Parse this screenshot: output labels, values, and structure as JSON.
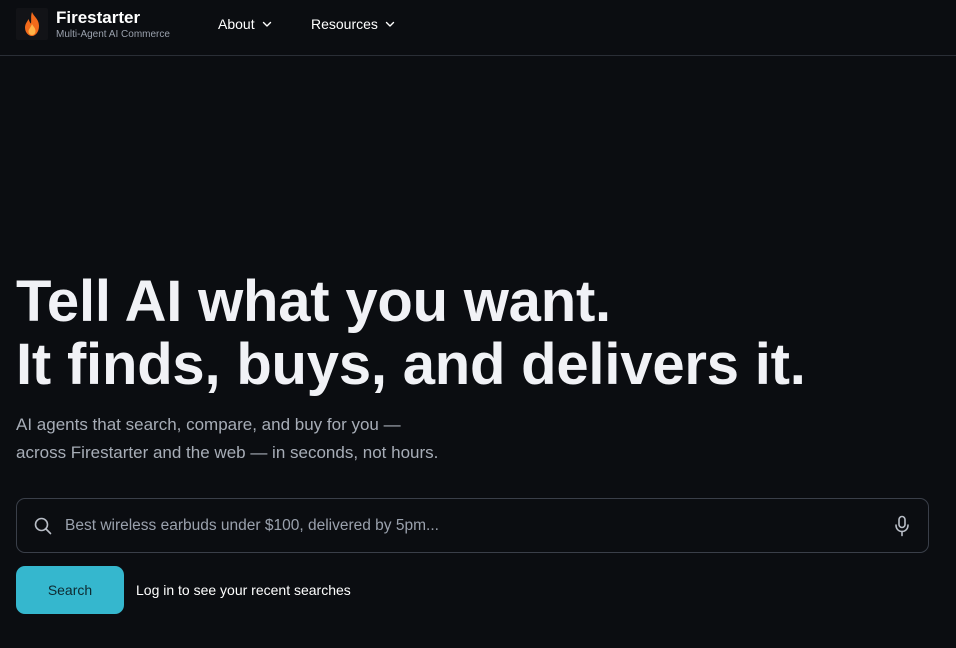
{
  "brand": {
    "name": "Firestarter",
    "tagline": "Multi-Agent AI Commerce",
    "logo_icon": "flame-icon",
    "accent_color": "#f26a1b"
  },
  "nav": {
    "items": [
      {
        "label": "About",
        "icon": "chevron-down-icon"
      },
      {
        "label": "Resources",
        "icon": "chevron-down-icon"
      }
    ]
  },
  "hero": {
    "title_lines": [
      "Tell AI what you want.",
      "It finds, buys, and delivers it."
    ],
    "subtitle_lines": [
      "AI agents that search, compare, and buy for you —",
      "across Firestarter and the web — in seconds, not hours."
    ]
  },
  "search": {
    "value": "",
    "placeholder": "Best wireless earbuds under $100, delivered by 5pm...",
    "search_icon": "search-icon",
    "mic_icon": "microphone-icon",
    "button_label": "Search",
    "button_color": "#35b7ce",
    "login_hint": "Log in to see your recent searches"
  }
}
